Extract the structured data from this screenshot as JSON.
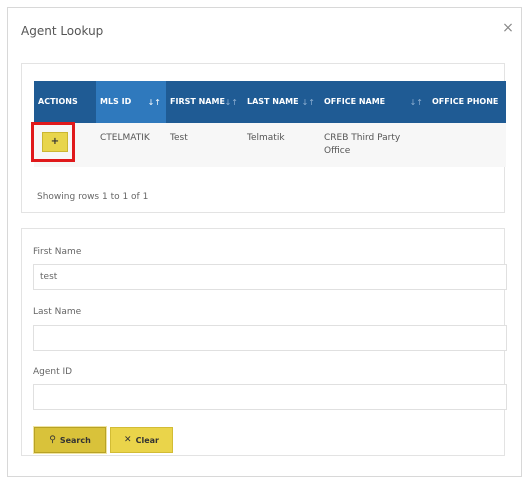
{
  "modal": {
    "title": "Agent Lookup",
    "close_icon": "×"
  },
  "table": {
    "columns": [
      {
        "label": "ACTIONS",
        "sortable": false
      },
      {
        "label": "MLS ID",
        "sortable": true
      },
      {
        "label": "FIRST NAME",
        "sortable": true
      },
      {
        "label": "LAST NAME",
        "sortable": true
      },
      {
        "label": "OFFICE NAME",
        "sortable": true
      },
      {
        "label": "OFFICE PHONE",
        "sortable": false
      }
    ],
    "sort_icon": "↓↑",
    "active_sort_icon": "↓↑",
    "rows": [
      {
        "action_label": "+",
        "mls_id": "CTELMATIK",
        "first_name": "Test",
        "last_name": "Telmatik",
        "office_name": "CREB Third Party Office",
        "office_phone": ""
      }
    ],
    "rows_info": "Showing rows 1 to 1 of 1"
  },
  "form": {
    "first_name_label": "First Name",
    "first_name_value": "test",
    "last_name_label": "Last Name",
    "last_name_value": "",
    "agent_id_label": "Agent ID",
    "agent_id_value": "",
    "search_label": "Search",
    "search_icon": "⚲",
    "clear_label": "Clear",
    "clear_icon": "✕"
  },
  "colors": {
    "header_bg": "#1f5b94",
    "active_header_bg": "#2f79bd",
    "button_yellow": "#ead44a",
    "highlight_red": "#e0191b"
  }
}
